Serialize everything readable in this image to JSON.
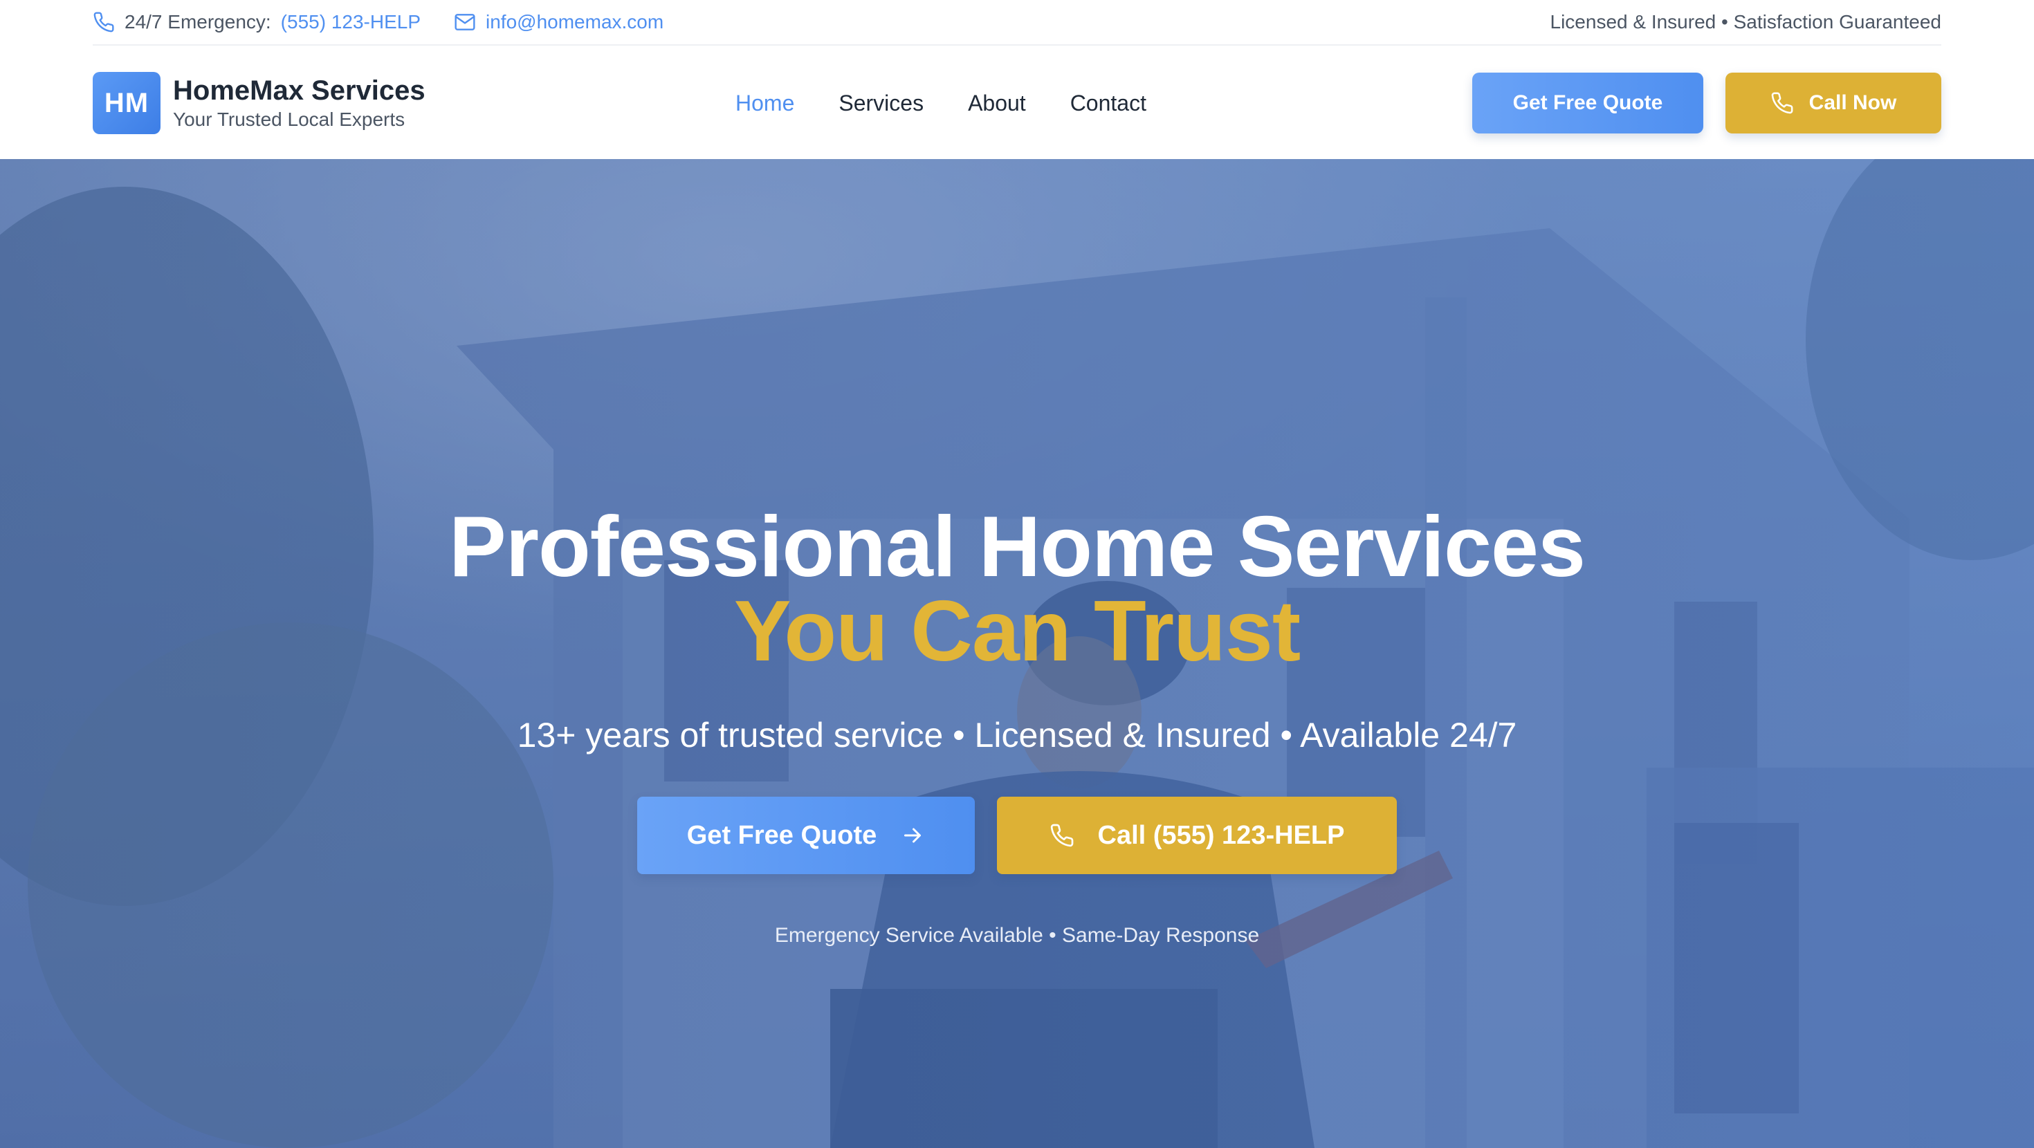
{
  "topbar": {
    "emergency_label": "24/7 Emergency:",
    "emergency_phone": "(555) 123-HELP",
    "email": "info@homemax.com",
    "right_text": "Licensed & Insured • Satisfaction Guaranteed"
  },
  "header": {
    "logo_initials": "HM",
    "brand_name": "HomeMax Services",
    "brand_tagline": "Your Trusted Local Experts",
    "nav": [
      {
        "label": "Home",
        "active": true
      },
      {
        "label": "Services",
        "active": false
      },
      {
        "label": "About",
        "active": false
      },
      {
        "label": "Contact",
        "active": false
      }
    ],
    "quote_button": "Get Free Quote",
    "call_button": "Call Now"
  },
  "hero": {
    "title_line1": "Professional Home Services",
    "title_line2": "You Can Trust",
    "subtitle": "13+ years of trusted service • Licensed & Insured • Available 24/7",
    "primary_button": "Get Free Quote",
    "secondary_button": "Call (555) 123-HELP",
    "note": "Emergency Service Available • Same-Day Response"
  },
  "colors": {
    "accent_blue": "#4f8ff0",
    "accent_gold": "#ddb135",
    "text_dark": "#1f2937"
  },
  "icons": {
    "phone": "phone-icon",
    "mail": "mail-icon",
    "arrow": "arrow-right-icon"
  }
}
